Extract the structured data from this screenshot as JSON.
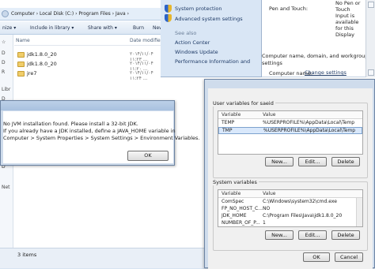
{
  "explorer": {
    "breadcrumb": "Computer › Local Disk (C:) › Program Files › Java ›",
    "toolbar": {
      "organize": "nize ▾",
      "include": "Include in library ▾",
      "share": "Share with ▾",
      "burn": "Burn",
      "newfolder": "New fol"
    },
    "columns": {
      "name": "Name",
      "date": "Date modified"
    },
    "files": [
      {
        "name": "jdk1.8.0_20",
        "date": "۲۰۱۴/۱۱/۰۴ ۱۱:۲۳ ..."
      },
      {
        "name": "jdk1.8.0_20",
        "date": "۲۰۱۴/۱۱/۰۴ ۱۱:۲۰ ..."
      },
      {
        "name": "jre7",
        "date": "۲۰۱۴/۱۱/۰۴ ۱۱:۲۴ ..."
      }
    ],
    "nav_items": [
      "☆",
      "D",
      "D",
      "R",
      "Libr",
      "D",
      "M",
      "P",
      "V",
      "C",
      "D",
      "D",
      "Net"
    ],
    "status": "3 items"
  },
  "control_panel": {
    "links": [
      "System protection",
      "Advanced system settings"
    ],
    "see_also": "See also",
    "see_also_links": [
      "Action Center",
      "Windows Update",
      "Performance Information and"
    ],
    "pen_touch_label": "Pen and Touch:",
    "pen_touch_value": [
      "No Pen or",
      "Touch",
      "Input is",
      "available",
      "for this",
      "Display"
    ],
    "computer_name_text": [
      "Computer name, domain, and workgroup",
      "settings"
    ],
    "computer_name_label": "Computer name:",
    "change_settings": "Change settings"
  },
  "jvm_dialog": {
    "messages": [
      "No JVM installation found. Please install a 32-bit JDK.",
      "If you already have a JDK installed, define a JAVA_HOME variable in",
      "Computer > System Properties > System Settings > Environment Variables."
    ],
    "ok": "OK"
  },
  "env_dialog": {
    "user_group": "User variables for saeid",
    "system_group": "System variables",
    "col_variable": "Variable",
    "col_value": "Value",
    "user_vars": [
      {
        "name": "TEMP",
        "value": "%USERPROFILE%\\AppData\\Local\\Temp"
      },
      {
        "name": "TMP",
        "value": "%USERPROFILE%\\AppData\\Local\\Temp"
      }
    ],
    "system_vars": [
      {
        "name": "ComSpec",
        "value": "C:\\Windows\\system32\\cmd.exe"
      },
      {
        "name": "FP_NO_HOST_C...",
        "value": "NO"
      },
      {
        "name": "JDK_HOME",
        "value": "C:\\Program Files\\Java\\jdk1.8.0_20"
      },
      {
        "name": "NUMBER_OF_P...",
        "value": "1"
      }
    ],
    "new": "New...",
    "edit": "Edit...",
    "delete": "Delete",
    "ok": "OK",
    "cancel": "Cancel"
  }
}
